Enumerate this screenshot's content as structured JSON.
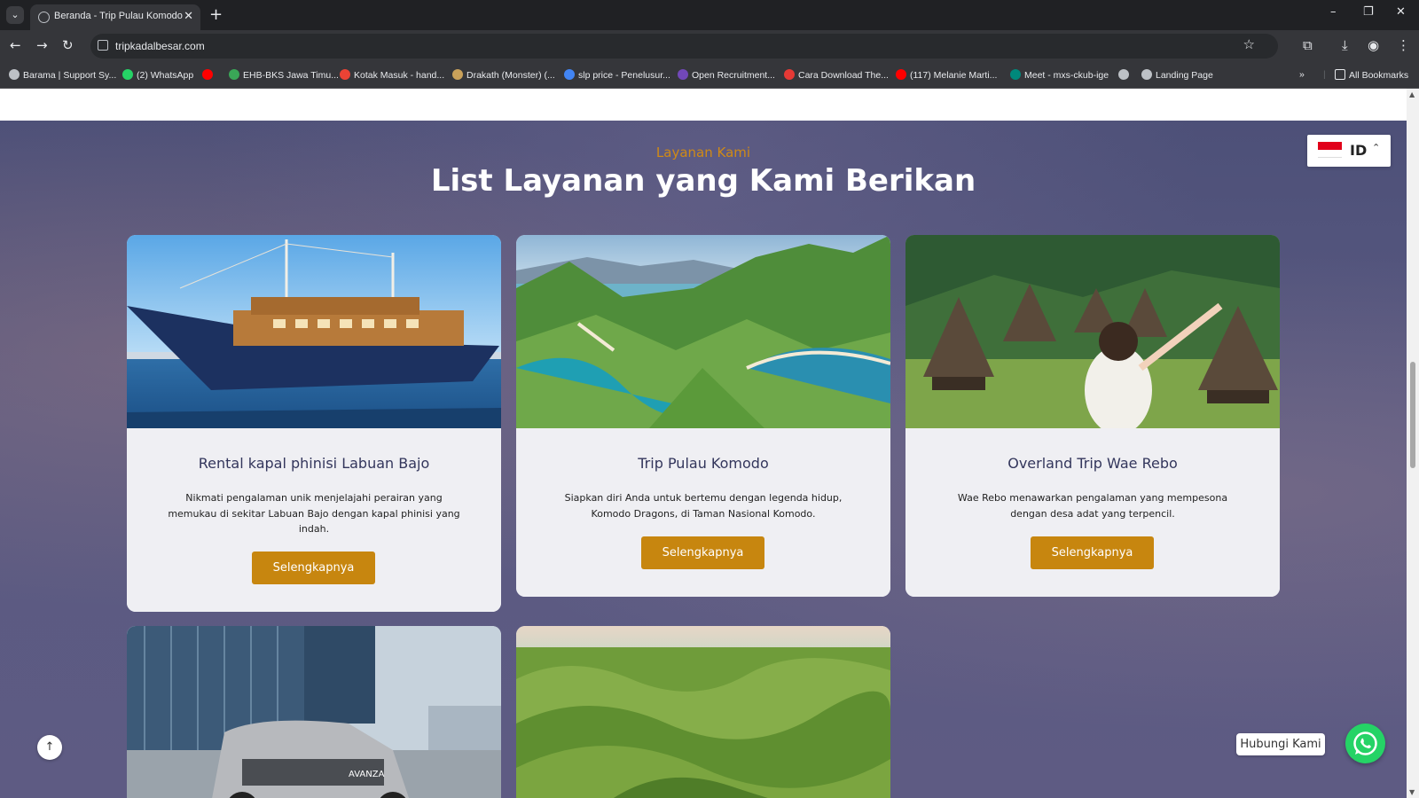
{
  "browser": {
    "tab_title": "Beranda - Trip Pulau Komodo",
    "tab_close": "✕",
    "new_tab": "+",
    "tab_list": "⌄",
    "url": "tripkadalbesar.com",
    "window_controls": {
      "minimize": "–",
      "restore": "❐",
      "close": "✕"
    },
    "bookmarks": [
      {
        "label": "Barama | Support Sy...",
        "icon": "globe-icon",
        "color": "#bdc1c6"
      },
      {
        "label": "(2) WhatsApp",
        "icon": "whatsapp-icon",
        "color": "#25d366"
      },
      {
        "label": "",
        "icon": "youtube-icon",
        "color": "#ff0000"
      },
      {
        "label": "EHB-BKS Jawa Timu...",
        "icon": "site-icon",
        "color": "#3aa757"
      },
      {
        "label": "Kotak Masuk - hand...",
        "icon": "gmail-icon",
        "color": "#ea4335"
      },
      {
        "label": "Drakath (Monster) (...",
        "icon": "site-icon",
        "color": "#c9a15a"
      },
      {
        "label": "slp price - Penelusur...",
        "icon": "google-icon",
        "color": "#4285f4"
      },
      {
        "label": "Open Recruitment...",
        "icon": "forms-icon",
        "color": "#7248b9"
      },
      {
        "label": "Cara Download The...",
        "icon": "site-icon",
        "color": "#e53935"
      },
      {
        "label": "(117) Melanie Marti...",
        "icon": "youtube-icon",
        "color": "#ff0000"
      },
      {
        "label": "Meet - mxs-ckub-ige",
        "icon": "meet-icon",
        "color": "#00897b"
      },
      {
        "label": "",
        "icon": "globe-icon",
        "color": "#bdc1c6"
      },
      {
        "label": "Landing Page",
        "icon": "globe-icon",
        "color": "#bdc1c6"
      }
    ],
    "bookmarks_overflow": "»",
    "all_bookmarks": "All Bookmarks"
  },
  "page": {
    "language": {
      "code": "ID",
      "caret": "⌃"
    },
    "section": {
      "eyebrow": "Layanan Kami",
      "title": "List Layanan yang Kami Berikan"
    },
    "cards": [
      {
        "title": "Rental kapal phinisi Labuan Bajo",
        "description": "Nikmati pengalaman unik menjelajahi perairan yang memukau di sekitar Labuan Bajo dengan kapal phinisi yang indah.",
        "button": "Selengkapnya",
        "image": "phinisi-boat"
      },
      {
        "title": "Trip Pulau Komodo",
        "description": "Siapkan diri Anda untuk bertemu dengan legenda hidup, Komodo Dragons, di Taman Nasional Komodo.",
        "button": "Selengkapnya",
        "image": "padar-island"
      },
      {
        "title": "Overland Trip Wae Rebo",
        "description": "Wae Rebo menawarkan pengalaman yang mempesona dengan desa adat yang terpencil.",
        "button": "Selengkapnya",
        "image": "wae-rebo-village"
      },
      {
        "image": "toyota-avanza",
        "car_badge": "AVANZA"
      },
      {
        "image": "green-hills"
      }
    ],
    "scroll_top": "↑",
    "whatsapp_label": "Hubungi Kami"
  }
}
